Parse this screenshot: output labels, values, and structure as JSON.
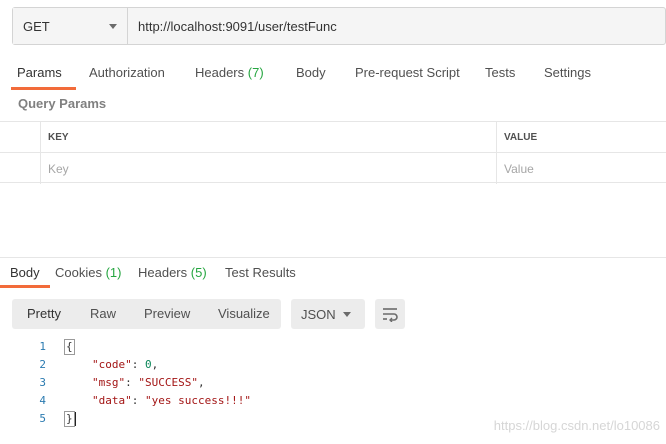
{
  "request": {
    "method": "GET",
    "url": "http://localhost:9091/user/testFunc"
  },
  "request_tabs": [
    {
      "label": "Params",
      "active": true
    },
    {
      "label": "Authorization"
    },
    {
      "label": "Headers",
      "count": "(7)"
    },
    {
      "label": "Body"
    },
    {
      "label": "Pre-request Script"
    },
    {
      "label": "Tests"
    },
    {
      "label": "Settings"
    }
  ],
  "query_params": {
    "title": "Query Params",
    "columns": {
      "key": "KEY",
      "value": "VALUE"
    },
    "placeholders": {
      "key": "Key",
      "value": "Value"
    }
  },
  "response_tabs": [
    {
      "label": "Body",
      "active": true
    },
    {
      "label": "Cookies",
      "count": "(1)"
    },
    {
      "label": "Headers",
      "count": "(5)"
    },
    {
      "label": "Test Results"
    }
  ],
  "view_modes": [
    "Pretty",
    "Raw",
    "Preview",
    "Visualize"
  ],
  "format": "JSON",
  "response_body": {
    "line_numbers": [
      "1",
      "2",
      "3",
      "4",
      "5"
    ],
    "open_brace": "{",
    "close_brace": "}",
    "fields": [
      {
        "key": "\"code\"",
        "sep": ": ",
        "value": "0",
        "tail": ",",
        "type": "num"
      },
      {
        "key": "\"msg\"",
        "sep": ": ",
        "value": "\"SUCCESS\"",
        "tail": ",",
        "type": "str"
      },
      {
        "key": "\"data\"",
        "sep": ": ",
        "value": "\"yes success!!!\"",
        "tail": "",
        "type": "str"
      }
    ]
  },
  "watermark": "https://blog.csdn.net/lo10086",
  "colors": {
    "accent": "#f26b3a",
    "count": "#26a641"
  }
}
